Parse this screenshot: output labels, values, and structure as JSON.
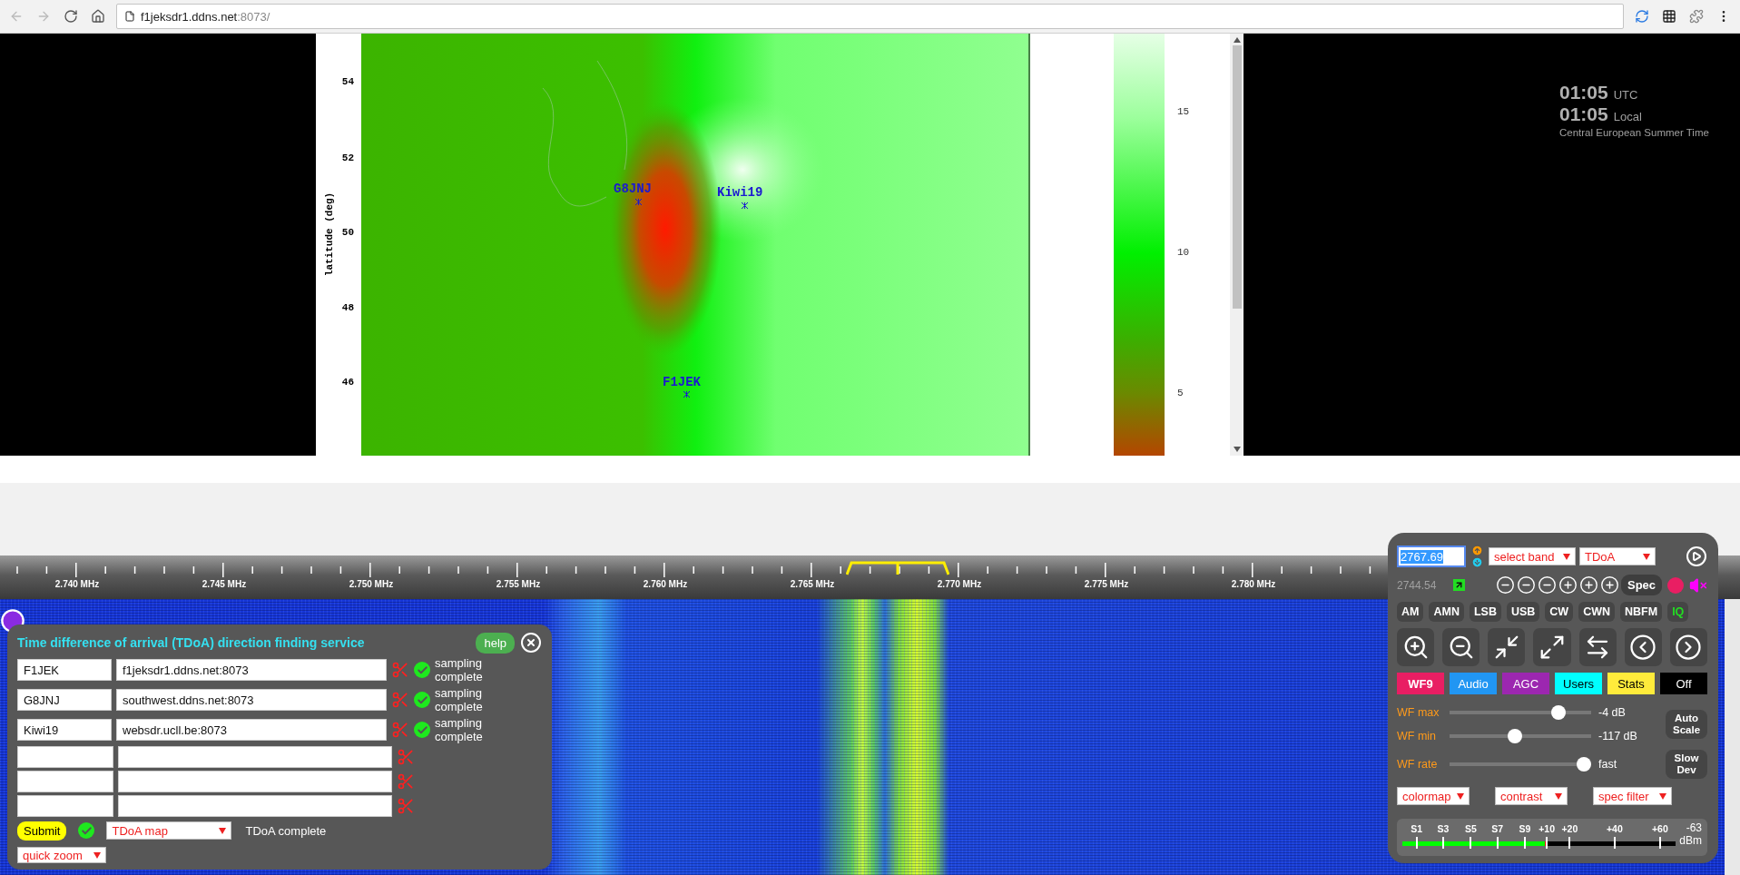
{
  "browser": {
    "url_host": "f1jeksdr1.ddns.net",
    "url_path": ":8073/"
  },
  "map_plot": {
    "ylabel": "latitude (deg)",
    "yticks": [
      "54",
      "52",
      "50",
      "48",
      "46"
    ],
    "stations": [
      {
        "name": "G8JNJ"
      },
      {
        "name": "Kiwi19"
      },
      {
        "name": "F1JEK"
      }
    ],
    "colorbar_ticks": [
      "15",
      "10",
      "5"
    ]
  },
  "clock": {
    "utc_time": "01:05",
    "utc_label": "UTC",
    "local_time": "01:05",
    "local_label": "Local",
    "timezone": "Central European Summer Time"
  },
  "frequency_scale": {
    "labels": [
      "2.740 MHz",
      "2.745 MHz",
      "2.750 MHz",
      "2.755 MHz",
      "2.760 MHz",
      "2.765 MHz",
      "2.770 MHz",
      "2.775 MHz",
      "2.780 MHz"
    ]
  },
  "tdoa_panel": {
    "title": "Time difference of arrival (TDoA) direction finding service",
    "help": "help",
    "rows": [
      {
        "name": "F1JEK",
        "host": "f1jeksdr1.ddns.net:8073",
        "status": "sampling complete"
      },
      {
        "name": "G8JNJ",
        "host": "southwest.ddns.net:8073",
        "status": "sampling complete"
      },
      {
        "name": "Kiwi19",
        "host": "websdr.ucll.be:8073",
        "status": "sampling complete"
      },
      {},
      {},
      {}
    ],
    "submit": "Submit",
    "result_select": "TDoA map",
    "result_status": "TDoA complete",
    "zoom_select": "quick zoom"
  },
  "control_panel": {
    "frequency": "2767.69",
    "band_select": "select band",
    "mode_select": "TDoA",
    "passband_freq": "2744.54",
    "spec_button": "Spec",
    "modes": [
      {
        "label": "AM",
        "selected": false
      },
      {
        "label": "AMN",
        "selected": false
      },
      {
        "label": "LSB",
        "selected": false
      },
      {
        "label": "USB",
        "selected": false
      },
      {
        "label": "CW",
        "selected": false
      },
      {
        "label": "CWN",
        "selected": false
      },
      {
        "label": "NBFM",
        "selected": false
      },
      {
        "label": "IQ",
        "selected": true
      }
    ],
    "tabs": [
      {
        "label": "WF9",
        "color": "#e91e63"
      },
      {
        "label": "Audio",
        "color": "#2196f3"
      },
      {
        "label": "AGC",
        "color": "#9c27b0"
      },
      {
        "label": "Users",
        "color": "#00ffff"
      },
      {
        "label": "Stats",
        "color": "#ffeb3b"
      },
      {
        "label": "Off",
        "color": "#000000"
      }
    ],
    "sliders": [
      {
        "label": "WF max",
        "level": 0.77,
        "reading": "-4 dB"
      },
      {
        "label": "WF min",
        "level": 0.46,
        "reading": "-117 dB"
      },
      {
        "label": "WF rate",
        "level": 0.95,
        "reading": "fast"
      }
    ],
    "side_buttons": [
      "Auto Scale",
      "Slow Dev"
    ],
    "dropdowns": [
      "colormap",
      "contrast",
      "spec filter"
    ],
    "meter": {
      "labels": [
        "S1",
        "S3",
        "S5",
        "S7",
        "S9",
        "+10",
        "+20",
        "+40",
        "+60"
      ],
      "level": 0.53,
      "reading": "-63",
      "unit": "dBm"
    }
  }
}
